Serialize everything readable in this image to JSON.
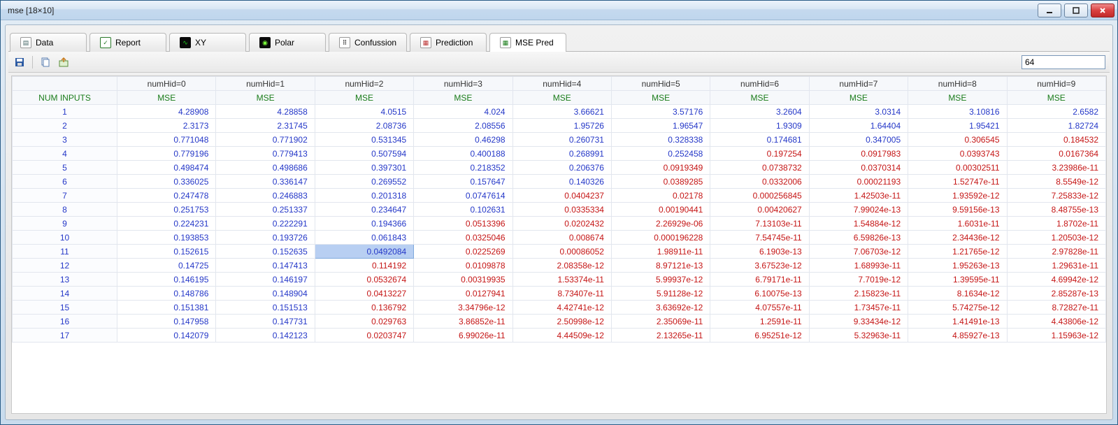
{
  "window": {
    "title": "mse [18×10]"
  },
  "tabs": [
    {
      "label": "Data",
      "icon": "data"
    },
    {
      "label": "Report",
      "icon": "report"
    },
    {
      "label": "XY",
      "icon": "xy"
    },
    {
      "label": "Polar",
      "icon": "polar"
    },
    {
      "label": "Confussion",
      "icon": "conf"
    },
    {
      "label": "Prediction",
      "icon": "pred"
    },
    {
      "label": "MSE Pred",
      "icon": "mse"
    }
  ],
  "activeTabIndex": 6,
  "toolbar": {
    "inputValue": "64"
  },
  "grid": {
    "firstColHeader": "NUM INPUTS",
    "colHeaders": [
      "numHid=0",
      "numHid=1",
      "numHid=2",
      "numHid=3",
      "numHid=4",
      "numHid=5",
      "numHid=6",
      "numHid=7",
      "numHid=8",
      "numHid=9"
    ],
    "subHeader": "MSE",
    "rows": [
      {
        "label": "1",
        "cells": [
          {
            "v": "4.28908",
            "c": "blue"
          },
          {
            "v": "4.28858",
            "c": "blue"
          },
          {
            "v": "4.0515",
            "c": "blue"
          },
          {
            "v": "4.024",
            "c": "blue"
          },
          {
            "v": "3.66621",
            "c": "blue"
          },
          {
            "v": "3.57176",
            "c": "blue"
          },
          {
            "v": "3.2604",
            "c": "blue"
          },
          {
            "v": "3.0314",
            "c": "blue"
          },
          {
            "v": "3.10816",
            "c": "blue"
          },
          {
            "v": "2.6582",
            "c": "blue"
          }
        ]
      },
      {
        "label": "2",
        "cells": [
          {
            "v": "2.3173",
            "c": "blue"
          },
          {
            "v": "2.31745",
            "c": "blue"
          },
          {
            "v": "2.08736",
            "c": "blue"
          },
          {
            "v": "2.08556",
            "c": "blue"
          },
          {
            "v": "1.95726",
            "c": "blue"
          },
          {
            "v": "1.96547",
            "c": "blue"
          },
          {
            "v": "1.9309",
            "c": "blue"
          },
          {
            "v": "1.64404",
            "c": "blue"
          },
          {
            "v": "1.95421",
            "c": "blue"
          },
          {
            "v": "1.82724",
            "c": "blue"
          }
        ]
      },
      {
        "label": "3",
        "cells": [
          {
            "v": "0.771048",
            "c": "blue"
          },
          {
            "v": "0.771902",
            "c": "blue"
          },
          {
            "v": "0.531345",
            "c": "blue"
          },
          {
            "v": "0.46298",
            "c": "blue"
          },
          {
            "v": "0.260731",
            "c": "blue"
          },
          {
            "v": "0.328338",
            "c": "blue"
          },
          {
            "v": "0.174681",
            "c": "blue"
          },
          {
            "v": "0.347005",
            "c": "blue"
          },
          {
            "v": "0.306545",
            "c": "red"
          },
          {
            "v": "0.184532",
            "c": "red"
          }
        ]
      },
      {
        "label": "4",
        "cells": [
          {
            "v": "0.779196",
            "c": "blue"
          },
          {
            "v": "0.779413",
            "c": "blue"
          },
          {
            "v": "0.507594",
            "c": "blue"
          },
          {
            "v": "0.400188",
            "c": "blue"
          },
          {
            "v": "0.268991",
            "c": "blue"
          },
          {
            "v": "0.252458",
            "c": "blue"
          },
          {
            "v": "0.197254",
            "c": "red"
          },
          {
            "v": "0.0917983",
            "c": "red"
          },
          {
            "v": "0.0393743",
            "c": "red"
          },
          {
            "v": "0.0167364",
            "c": "red"
          }
        ]
      },
      {
        "label": "5",
        "cells": [
          {
            "v": "0.498474",
            "c": "blue"
          },
          {
            "v": "0.498686",
            "c": "blue"
          },
          {
            "v": "0.397301",
            "c": "blue"
          },
          {
            "v": "0.218352",
            "c": "blue"
          },
          {
            "v": "0.206376",
            "c": "blue"
          },
          {
            "v": "0.0919349",
            "c": "red"
          },
          {
            "v": "0.0738732",
            "c": "red"
          },
          {
            "v": "0.0370314",
            "c": "red"
          },
          {
            "v": "0.00302511",
            "c": "red"
          },
          {
            "v": "3.23986e-11",
            "c": "red"
          }
        ]
      },
      {
        "label": "6",
        "cells": [
          {
            "v": "0.336025",
            "c": "blue"
          },
          {
            "v": "0.336147",
            "c": "blue"
          },
          {
            "v": "0.269552",
            "c": "blue"
          },
          {
            "v": "0.157647",
            "c": "blue"
          },
          {
            "v": "0.140326",
            "c": "blue"
          },
          {
            "v": "0.0389285",
            "c": "red"
          },
          {
            "v": "0.0332006",
            "c": "red"
          },
          {
            "v": "0.00021193",
            "c": "red"
          },
          {
            "v": "1.52747e-11",
            "c": "red"
          },
          {
            "v": "8.5549e-12",
            "c": "red"
          }
        ]
      },
      {
        "label": "7",
        "cells": [
          {
            "v": "0.247478",
            "c": "blue"
          },
          {
            "v": "0.246883",
            "c": "blue"
          },
          {
            "v": "0.201318",
            "c": "blue"
          },
          {
            "v": "0.0747614",
            "c": "blue"
          },
          {
            "v": "0.0404237",
            "c": "red"
          },
          {
            "v": "0.02178",
            "c": "red"
          },
          {
            "v": "0.000256845",
            "c": "red"
          },
          {
            "v": "1.42503e-11",
            "c": "red"
          },
          {
            "v": "1.93592e-12",
            "c": "red"
          },
          {
            "v": "7.25833e-12",
            "c": "red"
          }
        ]
      },
      {
        "label": "8",
        "cells": [
          {
            "v": "0.251753",
            "c": "blue"
          },
          {
            "v": "0.251337",
            "c": "blue"
          },
          {
            "v": "0.234647",
            "c": "blue"
          },
          {
            "v": "0.102631",
            "c": "blue"
          },
          {
            "v": "0.0335334",
            "c": "red"
          },
          {
            "v": "0.00190441",
            "c": "red"
          },
          {
            "v": "0.00420627",
            "c": "red"
          },
          {
            "v": "7.99024e-13",
            "c": "red"
          },
          {
            "v": "9.59156e-13",
            "c": "red"
          },
          {
            "v": "8.48755e-13",
            "c": "red"
          }
        ]
      },
      {
        "label": "9",
        "cells": [
          {
            "v": "0.224231",
            "c": "blue"
          },
          {
            "v": "0.222291",
            "c": "blue"
          },
          {
            "v": "0.194366",
            "c": "blue"
          },
          {
            "v": "0.0513396",
            "c": "red"
          },
          {
            "v": "0.0202432",
            "c": "red"
          },
          {
            "v": "2.26929e-06",
            "c": "red"
          },
          {
            "v": "7.13103e-11",
            "c": "red"
          },
          {
            "v": "1.54884e-12",
            "c": "red"
          },
          {
            "v": "1.6031e-11",
            "c": "red"
          },
          {
            "v": "1.8702e-11",
            "c": "red"
          }
        ]
      },
      {
        "label": "10",
        "cells": [
          {
            "v": "0.193853",
            "c": "blue"
          },
          {
            "v": "0.193726",
            "c": "blue"
          },
          {
            "v": "0.061843",
            "c": "blue"
          },
          {
            "v": "0.0325046",
            "c": "red"
          },
          {
            "v": "0.008674",
            "c": "red"
          },
          {
            "v": "0.000196228",
            "c": "red"
          },
          {
            "v": "7.54745e-11",
            "c": "red"
          },
          {
            "v": "6.59826e-13",
            "c": "red"
          },
          {
            "v": "2.34436e-12",
            "c": "red"
          },
          {
            "v": "1.20503e-12",
            "c": "red"
          }
        ]
      },
      {
        "label": "11",
        "cells": [
          {
            "v": "0.152615",
            "c": "blue"
          },
          {
            "v": "0.152635",
            "c": "blue"
          },
          {
            "v": "0.0492084",
            "c": "blue",
            "sel": true
          },
          {
            "v": "0.0225269",
            "c": "red"
          },
          {
            "v": "0.00086052",
            "c": "red"
          },
          {
            "v": "1.98911e-11",
            "c": "red"
          },
          {
            "v": "6.1903e-13",
            "c": "red"
          },
          {
            "v": "7.06703e-12",
            "c": "red"
          },
          {
            "v": "1.21765e-12",
            "c": "red"
          },
          {
            "v": "2.97828e-11",
            "c": "red"
          }
        ]
      },
      {
        "label": "12",
        "cells": [
          {
            "v": "0.14725",
            "c": "blue"
          },
          {
            "v": "0.147413",
            "c": "blue"
          },
          {
            "v": "0.114192",
            "c": "red"
          },
          {
            "v": "0.0109878",
            "c": "red"
          },
          {
            "v": "2.08358e-12",
            "c": "red"
          },
          {
            "v": "8.97121e-13",
            "c": "red"
          },
          {
            "v": "3.67523e-12",
            "c": "red"
          },
          {
            "v": "1.68993e-11",
            "c": "red"
          },
          {
            "v": "1.95263e-13",
            "c": "red"
          },
          {
            "v": "1.29631e-11",
            "c": "red"
          }
        ]
      },
      {
        "label": "13",
        "cells": [
          {
            "v": "0.146195",
            "c": "blue"
          },
          {
            "v": "0.146197",
            "c": "blue"
          },
          {
            "v": "0.0532674",
            "c": "red"
          },
          {
            "v": "0.00319935",
            "c": "red"
          },
          {
            "v": "1.53374e-11",
            "c": "red"
          },
          {
            "v": "5.99937e-12",
            "c": "red"
          },
          {
            "v": "6.79171e-11",
            "c": "red"
          },
          {
            "v": "7.7019e-12",
            "c": "red"
          },
          {
            "v": "1.39595e-11",
            "c": "red"
          },
          {
            "v": "4.69942e-12",
            "c": "red"
          }
        ]
      },
      {
        "label": "14",
        "cells": [
          {
            "v": "0.148786",
            "c": "blue"
          },
          {
            "v": "0.148904",
            "c": "blue"
          },
          {
            "v": "0.0413227",
            "c": "red"
          },
          {
            "v": "0.0127941",
            "c": "red"
          },
          {
            "v": "8.73407e-11",
            "c": "red"
          },
          {
            "v": "5.91128e-12",
            "c": "red"
          },
          {
            "v": "6.10075e-13",
            "c": "red"
          },
          {
            "v": "2.15823e-11",
            "c": "red"
          },
          {
            "v": "8.1634e-12",
            "c": "red"
          },
          {
            "v": "2.85287e-13",
            "c": "red"
          }
        ]
      },
      {
        "label": "15",
        "cells": [
          {
            "v": "0.151381",
            "c": "blue"
          },
          {
            "v": "0.151513",
            "c": "blue"
          },
          {
            "v": "0.136792",
            "c": "red"
          },
          {
            "v": "3.34796e-12",
            "c": "red"
          },
          {
            "v": "4.42741e-12",
            "c": "red"
          },
          {
            "v": "3.63692e-12",
            "c": "red"
          },
          {
            "v": "4.07557e-11",
            "c": "red"
          },
          {
            "v": "1.73457e-11",
            "c": "red"
          },
          {
            "v": "5.74275e-12",
            "c": "red"
          },
          {
            "v": "8.72827e-11",
            "c": "red"
          }
        ]
      },
      {
        "label": "16",
        "cells": [
          {
            "v": "0.147958",
            "c": "blue"
          },
          {
            "v": "0.147731",
            "c": "blue"
          },
          {
            "v": "0.029763",
            "c": "red"
          },
          {
            "v": "3.86852e-11",
            "c": "red"
          },
          {
            "v": "2.50998e-12",
            "c": "red"
          },
          {
            "v": "2.35069e-11",
            "c": "red"
          },
          {
            "v": "1.2591e-11",
            "c": "red"
          },
          {
            "v": "9.33434e-12",
            "c": "red"
          },
          {
            "v": "1.41491e-13",
            "c": "red"
          },
          {
            "v": "4.43806e-12",
            "c": "red"
          }
        ]
      },
      {
        "label": "17",
        "cells": [
          {
            "v": "0.142079",
            "c": "blue"
          },
          {
            "v": "0.142123",
            "c": "blue"
          },
          {
            "v": "0.0203747",
            "c": "red"
          },
          {
            "v": "6.99026e-11",
            "c": "red"
          },
          {
            "v": "4.44509e-12",
            "c": "red"
          },
          {
            "v": "2.13265e-11",
            "c": "red"
          },
          {
            "v": "6.95251e-12",
            "c": "red"
          },
          {
            "v": "5.32963e-11",
            "c": "red"
          },
          {
            "v": "4.85927e-13",
            "c": "red"
          },
          {
            "v": "1.15963e-12",
            "c": "red"
          }
        ]
      }
    ]
  }
}
